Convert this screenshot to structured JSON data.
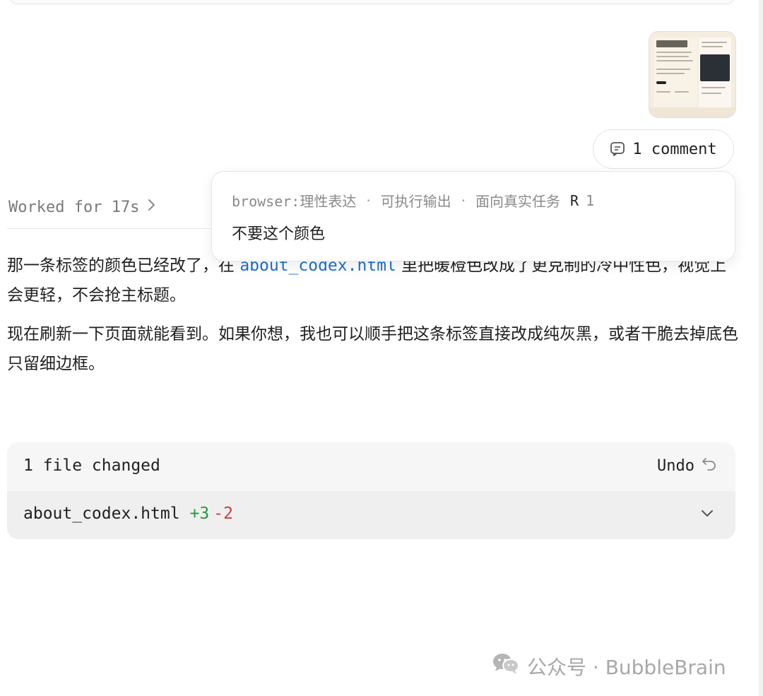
{
  "comment": {
    "icon": "comment-icon",
    "label": "1 comment"
  },
  "worked": {
    "label": "Worked for 17s",
    "chevron": "›"
  },
  "popover": {
    "source": "browser:理性表达",
    "sep1": "·",
    "tag1": "可执行输出",
    "sep2": "·",
    "tag2": "面向真实任务",
    "r_key": "R",
    "r_num": "1",
    "body": "不要这个颜色"
  },
  "message": {
    "p1_before": "那一条标签的颜色已经改了，在 ",
    "p1_code": "about_codex.html",
    "p1_after": " 里把暖橙色改成了更克制的冷中性色，视觉上会更轻，不会抢主标题。",
    "p2": "现在刷新一下页面就能看到。如果你想，我也可以顺手把这条标签直接改成纯灰黑，或者干脆去掉底色只留细边框。"
  },
  "files": {
    "title": "1 file changed",
    "undo_label": "Undo",
    "file_name": "about_codex.html",
    "additions": "+3",
    "deletions": "-2"
  },
  "watermark": {
    "text": "公众号 · BubbleBrain"
  },
  "colors": {
    "link": "#1d6fd1",
    "add": "#1f9d3a",
    "del": "#d23a3a"
  }
}
